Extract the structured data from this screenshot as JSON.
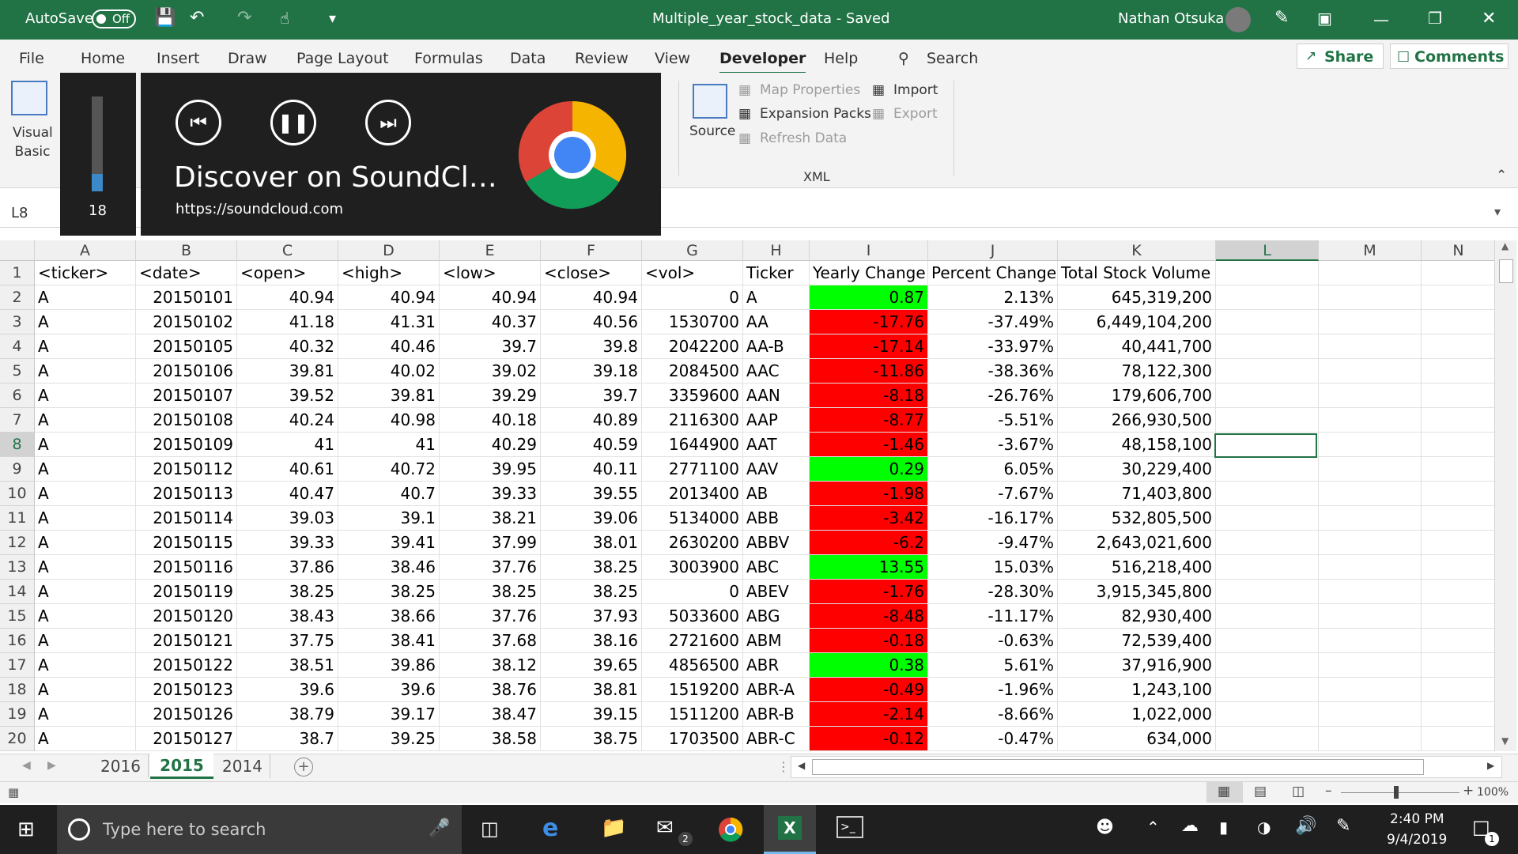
{
  "titlebar": {
    "autosave_label": "AutoSave",
    "autosave_state": "Off",
    "title": "Multiple_year_stock_data  -  Saved",
    "user": "Nathan Otsuka"
  },
  "tabs": [
    "File",
    "Home",
    "Insert",
    "Draw",
    "Page Layout",
    "Formulas",
    "Data",
    "Review",
    "View",
    "Developer",
    "Help"
  ],
  "search_label": "Search",
  "share_label": "Share",
  "comments_label": "Comments",
  "ribbon": {
    "visual_basic": "Visual Basic",
    "source": "Source",
    "map_properties": "Map Properties",
    "import": "Import",
    "expansion_packs": "Expansion Packs",
    "export": "Export",
    "refresh_data": "Refresh Data",
    "xml_group": "XML"
  },
  "namebox": "L8",
  "media": {
    "volume": "18",
    "title": "Discover on SoundCl…",
    "url": "https://soundcloud.com"
  },
  "columns": [
    "A",
    "B",
    "C",
    "D",
    "E",
    "F",
    "G",
    "H",
    "I",
    "J",
    "K",
    "L",
    "M",
    "N"
  ],
  "header_row": [
    "<ticker>",
    "<date>",
    "<open>",
    "<high>",
    "<low>",
    "<close>",
    "<vol>",
    "Ticker",
    "Yearly Change",
    "Percent Change",
    "Total Stock Volume"
  ],
  "rows": [
    [
      "A",
      "20150101",
      "40.94",
      "40.94",
      "40.94",
      "40.94",
      "0",
      "A",
      "0.87",
      "2.13%",
      "645,319,200"
    ],
    [
      "A",
      "20150102",
      "41.18",
      "41.31",
      "40.37",
      "40.56",
      "1530700",
      "AA",
      "-17.76",
      "-37.49%",
      "6,449,104,200"
    ],
    [
      "A",
      "20150105",
      "40.32",
      "40.46",
      "39.7",
      "39.8",
      "2042200",
      "AA-B",
      "-17.14",
      "-33.97%",
      "40,441,700"
    ],
    [
      "A",
      "20150106",
      "39.81",
      "40.02",
      "39.02",
      "39.18",
      "2084500",
      "AAC",
      "-11.86",
      "-38.36%",
      "78,122,300"
    ],
    [
      "A",
      "20150107",
      "39.52",
      "39.81",
      "39.29",
      "39.7",
      "3359600",
      "AAN",
      "-8.18",
      "-26.76%",
      "179,606,700"
    ],
    [
      "A",
      "20150108",
      "40.24",
      "40.98",
      "40.18",
      "40.89",
      "2116300",
      "AAP",
      "-8.77",
      "-5.51%",
      "266,930,500"
    ],
    [
      "A",
      "20150109",
      "41",
      "41",
      "40.29",
      "40.59",
      "1644900",
      "AAT",
      "-1.46",
      "-3.67%",
      "48,158,100"
    ],
    [
      "A",
      "20150112",
      "40.61",
      "40.72",
      "39.95",
      "40.11",
      "2771100",
      "AAV",
      "0.29",
      "6.05%",
      "30,229,400"
    ],
    [
      "A",
      "20150113",
      "40.47",
      "40.7",
      "39.33",
      "39.55",
      "2013400",
      "AB",
      "-1.98",
      "-7.67%",
      "71,403,800"
    ],
    [
      "A",
      "20150114",
      "39.03",
      "39.1",
      "38.21",
      "39.06",
      "5134000",
      "ABB",
      "-3.42",
      "-16.17%",
      "532,805,500"
    ],
    [
      "A",
      "20150115",
      "39.33",
      "39.41",
      "37.99",
      "38.01",
      "2630200",
      "ABBV",
      "-6.2",
      "-9.47%",
      "2,643,021,600"
    ],
    [
      "A",
      "20150116",
      "37.86",
      "38.46",
      "37.76",
      "38.25",
      "3003900",
      "ABC",
      "13.55",
      "15.03%",
      "516,218,400"
    ],
    [
      "A",
      "20150119",
      "38.25",
      "38.25",
      "38.25",
      "38.25",
      "0",
      "ABEV",
      "-1.76",
      "-28.30%",
      "3,915,345,800"
    ],
    [
      "A",
      "20150120",
      "38.43",
      "38.66",
      "37.76",
      "37.93",
      "5033600",
      "ABG",
      "-8.48",
      "-11.17%",
      "82,930,400"
    ],
    [
      "A",
      "20150121",
      "37.75",
      "38.41",
      "37.68",
      "38.16",
      "2721600",
      "ABM",
      "-0.18",
      "-0.63%",
      "72,539,400"
    ],
    [
      "A",
      "20150122",
      "38.51",
      "39.86",
      "38.12",
      "39.65",
      "4856500",
      "ABR",
      "0.38",
      "5.61%",
      "37,916,900"
    ],
    [
      "A",
      "20150123",
      "39.6",
      "39.6",
      "38.76",
      "38.81",
      "1519200",
      "ABR-A",
      "-0.49",
      "-1.96%",
      "1,243,100"
    ],
    [
      "A",
      "20150126",
      "38.79",
      "39.17",
      "38.47",
      "39.15",
      "1511200",
      "ABR-B",
      "-2.14",
      "-8.66%",
      "1,022,000"
    ],
    [
      "A",
      "20150127",
      "38.7",
      "39.25",
      "38.58",
      "38.75",
      "1703500",
      "ABR-C",
      "-0.12",
      "-0.47%",
      "634,000"
    ]
  ],
  "sheets": [
    "2016",
    "2015",
    "2014"
  ],
  "active_sheet": "2015",
  "zoom": "100%",
  "taskbar": {
    "search_placeholder": "Type here to search",
    "time": "2:40 PM",
    "date": "9/4/2019",
    "mail_badge": "2",
    "notif_badge": "1"
  },
  "colors": {
    "green": "#00ff00",
    "red": "#ff0000",
    "excel": "#217346"
  }
}
